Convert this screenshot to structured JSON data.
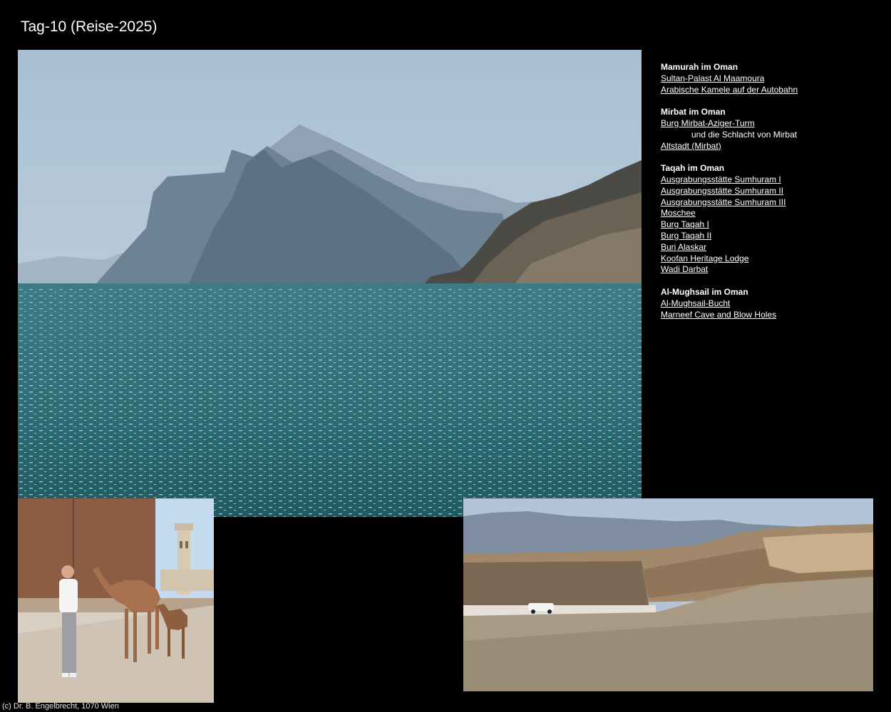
{
  "page": {
    "title": "Tag-10 (Reise-2025)",
    "footer": "(c) Dr. B. Engelbrecht, 1070 Wien"
  },
  "colors": {
    "background": "#000000",
    "text": "#ffffff",
    "sea": "#2f6f78",
    "sky": "#9fb9cc"
  },
  "nav": {
    "mamurah": {
      "heading": "Mamurah im Oman",
      "links": [
        "Sultan-Palast Al Maamoura",
        "Arabische Kamele auf der Autobahn"
      ]
    },
    "mirbat": {
      "heading": "Mirbat im Oman",
      "link1": "Burg Mirbat-Aziger-Turm",
      "note": "und die Schlacht von Mirbat",
      "link2": "Altstadt (Mirbat)"
    },
    "taqah": {
      "heading": "Taqah im Oman",
      "links": [
        "Ausgrabungsstätte Sumhuram I",
        "Ausgrabungsstätte Sumhuram II",
        "Ausgrabungsstätte Sumhuram III",
        "Moschee",
        "Burg Taqah I",
        "Burg Taqah II",
        "Burj Alaskar",
        "Koofan Heritage Lodge",
        "Wadi Darbat"
      ]
    },
    "mughsail": {
      "heading": "Al-Mughsail im Oman",
      "links": [
        "Al-Mughsail-Bucht",
        "Marneef Cave and Blow Holes"
      ]
    }
  }
}
